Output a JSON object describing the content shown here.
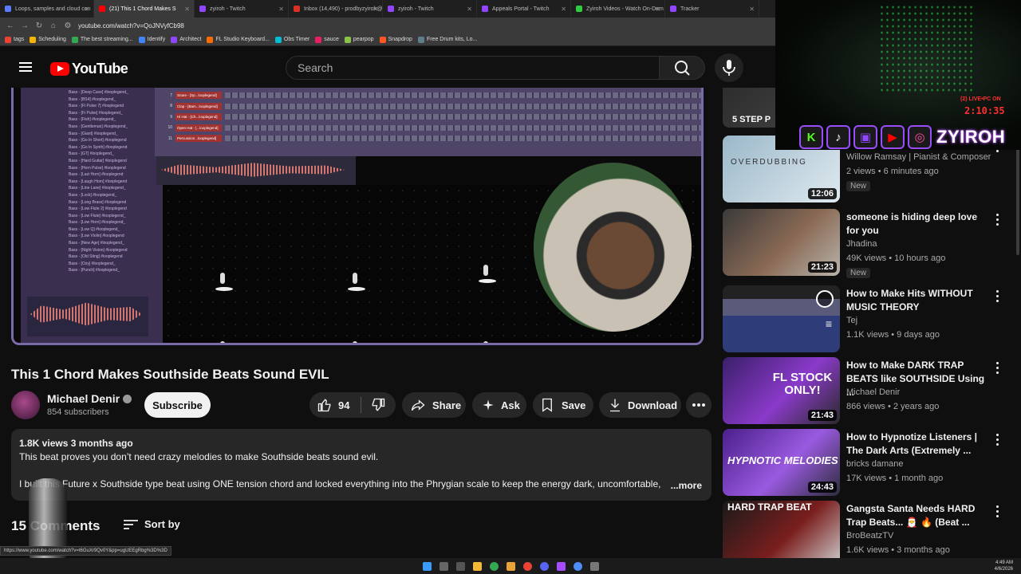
{
  "browser": {
    "tabs": [
      {
        "title": "Loops, samples and cloud con",
        "color": "#5b7cfa",
        "active": false
      },
      {
        "title": "(21) This 1 Chord Makes S",
        "color": "#ff0000",
        "active": true
      },
      {
        "title": "zyiroh - Twitch",
        "color": "#9146ff",
        "active": false
      },
      {
        "title": "Inbox (14,490) - prodbyzyiroh@",
        "color": "#d93025",
        "active": false
      },
      {
        "title": "zyiroh - Twitch",
        "color": "#9146ff",
        "active": false
      },
      {
        "title": "Appeals Portal - Twitch",
        "color": "#9146ff",
        "active": false
      },
      {
        "title": "Zyiroh Videos - Watch On-Dem",
        "color": "#2ecc40",
        "active": false
      },
      {
        "title": "Tracker",
        "color": "#9146ff",
        "active": false
      }
    ],
    "url": "youtube.com/watch?v=QoJNVyfCb98",
    "bookmarks": [
      "tags",
      "Scheduling",
      "The best streaming...",
      "Identify",
      "Architect",
      "FL Studio Keyboard...",
      "Obs Timer",
      "sauce",
      "pearpop",
      "Snapdrop",
      "Free Drum kits, Lo..."
    ]
  },
  "youtube": {
    "logo_text": "YouTube",
    "search_placeholder": "Search",
    "video": {
      "title": "This 1 Chord Makes Southside Beats Sound EVIL",
      "channel": "Michael Denir",
      "subscribers": "854 subscribers",
      "subscribe_label": "Subscribe",
      "likes": "94",
      "share_label": "Share",
      "ask_label": "Ask",
      "save_label": "Save",
      "download_label": "Download",
      "description": {
        "stats": "1.8K views  3 months ago",
        "line1": "This beat proves you don’t need crazy melodies to make Southside beats sound evil.",
        "line2": "I built this Future x Southside type beat using ONE tension chord and locked everything into the Phrygian scale to keep the energy dark, uncomfortable,",
        "more_label": "...more"
      },
      "comments_label": "15 Comments",
      "sort_label": "Sort by",
      "daw_tracks": [
        "Bass - [Deep Cave] #looplegend_",
        "Bass - [BS4] #looplegend_",
        "Bass - [Fi Pulse 7] #looplegend",
        "Bass - [Fi Pulse] #looplegend_",
        "Bass - [Fish] #looplegend_",
        "Bass - [Gentleman] #looplegend_",
        "Bass - [Giant] #looplegend_",
        "Bass - [Go In Short] #looplegend",
        "Bass - [Go In Synth] #looplegend",
        "Bass - [GT] #looplegend_",
        "Bass - [Hard Guitar] #looplegend",
        "Bass - [Horn Pulse] #looplegend",
        "Bass - [Lazi Horn] #looplegend",
        "Bass - [Laugh Horn] #looplegend",
        "Bass - [Line Lane] #looplegend_",
        "Bass - [Lock] #looplegend_",
        "Bass - [Long Brass] #looplegend",
        "Bass - [Low Flute 2] #looplegend",
        "Bass - [Low Flute] #looplegend_",
        "Bass - [Low Horn] #looplegend_",
        "Bass - [Low Q] #looplegend_",
        "Bass - [Low Violin] #looplegend",
        "Bass - [New Age] #looplegend_",
        "Bass - [Night Vision] #looplegend",
        "Bass - [Old Sting] #looplegend",
        "Bass - [Ozy] #looplegend_",
        "Bass - [Punch] #looplegend_"
      ],
      "rack_channels": [
        {
          "num": "7",
          "name": "Snare - [Sp...looplegend]"
        },
        {
          "num": "8",
          "name": "Clap - [Bam...looplegend]"
        },
        {
          "num": "9",
          "name": "Hi Hat - [Ch...looplegend]"
        },
        {
          "num": "10",
          "name": "Open Hat - [...looplegend]"
        },
        {
          "num": "11",
          "name": "Percussion...looplegend]"
        }
      ]
    },
    "recommendations": [
      {
        "title": "Overdubbing",
        "channel": "Willow Ramsay | Pianist & Composer",
        "meta": "2 views • 6 minutes ago",
        "badge": "New",
        "duration": "12:06"
      },
      {
        "title": "someone is hiding deep love for you",
        "channel": "Jhadina",
        "meta": "49K views • 10 hours ago",
        "badge": "New",
        "duration": "21:23"
      },
      {
        "title": "How to Make Hits WITHOUT MUSIC THEORY",
        "channel": "Tej",
        "meta": "1.1K views • 9 days ago",
        "badge": "",
        "duration": ""
      },
      {
        "title": "How to Make DARK TRAP BEATS like SOUTHSIDE Using ...",
        "channel": "Michael Denir",
        "meta": "866 views • 2 years ago",
        "badge": "",
        "duration": "21:43"
      },
      {
        "title": "How to Hypnotize Listeners | The Dark Arts (Extremely ...",
        "channel": "bricks damane",
        "meta": "17K views • 1 month ago",
        "badge": "",
        "duration": "24:43"
      },
      {
        "title": "Gangsta Santa Needs HARD Trap Beats... 🎅 🔥 (Beat ...",
        "channel": "BroBeatzTV",
        "meta": "1.6K views • 3 months ago",
        "badge": "",
        "duration": ""
      }
    ],
    "thumb_texts": {
      "step": "5 STEP P",
      "overdub": "OVERDUBBING",
      "flstock": "FL STOCK ONLY!",
      "hypnotic": "HYPNOTIC MELODIES",
      "hardtrap": "HARD TRAP BEAT"
    }
  },
  "overlay": {
    "live_text": "(2) LIVE•PC ON",
    "clock": "2:10:35",
    "handle": "ZYIROH"
  },
  "status_url": "https://www.youtube.com/watch?v=t6GuXr9Qv0Y&pp=ugUEEgRbg%3D%3D",
  "taskbar": {
    "time": "4:49 AM",
    "date": "4/6/2026"
  }
}
